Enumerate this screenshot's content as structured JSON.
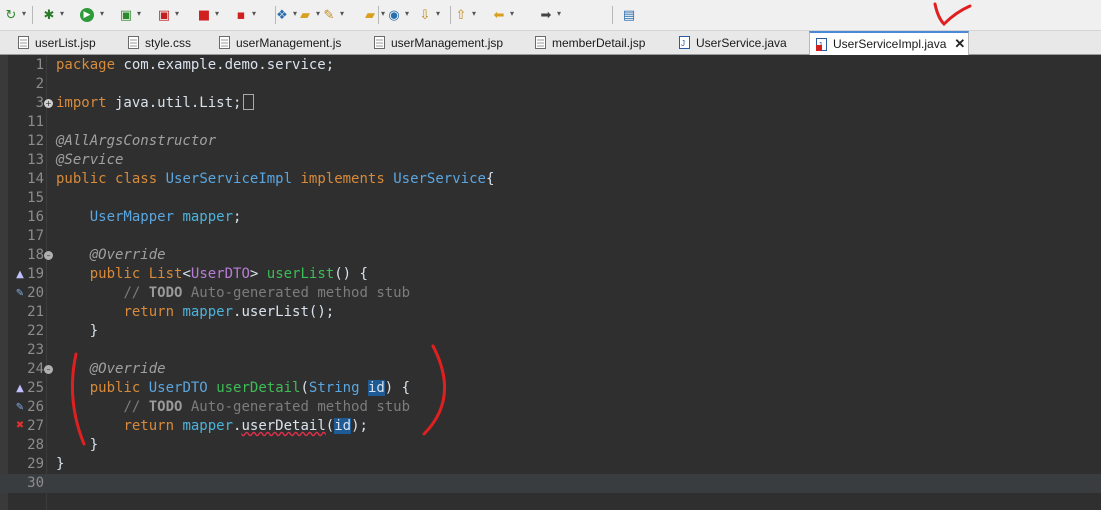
{
  "toolbar": {
    "icons": [
      "sync-icon",
      "debug-icon",
      "run-icon",
      "run-coverage-icon",
      "external-tools-icon",
      "stop-icon",
      "new-server-icon",
      "open-type-icon",
      "open-folder-icon",
      "edit-icon",
      "open-folder-2-icon",
      "globe-icon",
      "next-annotation-icon",
      "previous-annotation-icon",
      "back-icon",
      "forward-icon",
      "pin-editor-icon"
    ]
  },
  "tabs": [
    {
      "label": "userList.jsp",
      "type": "jsp"
    },
    {
      "label": "style.css",
      "type": "css"
    },
    {
      "label": "userManagement.js",
      "type": "js"
    },
    {
      "label": "userManagement.jsp",
      "type": "jsp"
    },
    {
      "label": "memberDetail.jsp",
      "type": "jsp"
    },
    {
      "label": "UserService.java",
      "type": "java"
    },
    {
      "label": "UserServiceImpl.java",
      "type": "java",
      "active": true,
      "close": "✕"
    }
  ],
  "editor": {
    "lines": [
      {
        "num": "1",
        "text": "package com.example.demo.service;"
      },
      {
        "num": "2",
        "text": ""
      },
      {
        "num": "3",
        "text": "import java.util.List;"
      },
      {
        "num": "11",
        "text": ""
      },
      {
        "num": "12",
        "text": "@AllArgsConstructor"
      },
      {
        "num": "13",
        "text": "@Service"
      },
      {
        "num": "14",
        "text": "public class UserServiceImpl implements UserService{"
      },
      {
        "num": "15",
        "text": ""
      },
      {
        "num": "16",
        "text": "    UserMapper mapper;"
      },
      {
        "num": "17",
        "text": ""
      },
      {
        "num": "18",
        "text": "    @Override"
      },
      {
        "num": "19",
        "text": "    public List<UserDTO> userList() {"
      },
      {
        "num": "20",
        "text": "        // TODO Auto-generated method stub"
      },
      {
        "num": "21",
        "text": "        return mapper.userList();"
      },
      {
        "num": "22",
        "text": "    }"
      },
      {
        "num": "23",
        "text": ""
      },
      {
        "num": "24",
        "text": "    @Override"
      },
      {
        "num": "25",
        "text": "    public UserDTO userDetail(String id) {"
      },
      {
        "num": "26",
        "text": "        // TODO Auto-generated method stub"
      },
      {
        "num": "27",
        "text": "        return mapper.userDetail(id);"
      },
      {
        "num": "28",
        "text": "    }"
      },
      {
        "num": "29",
        "text": "}"
      },
      {
        "num": "30",
        "text": ""
      }
    ]
  },
  "colors": {
    "editor_bg": "#2f2f2f",
    "keyword": "#d88a3a",
    "type": "#5aa6e0",
    "method": "#3dbd55",
    "comment": "#7c7c7c",
    "selection": "#1e5a94",
    "annotation_pen": "#e02020"
  }
}
